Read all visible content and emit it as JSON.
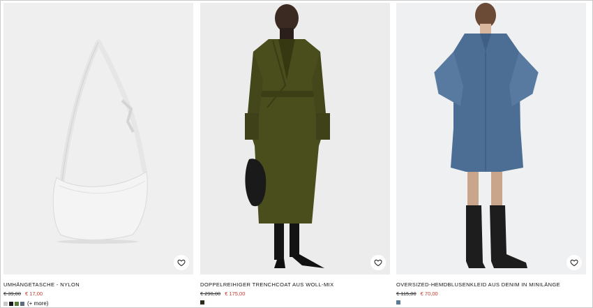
{
  "products": [
    {
      "name": "UMHÄNGETASCHE - NYLON",
      "old_price": "€ 39,00",
      "new_price": "€ 17,00",
      "swatches": [
        "#c8c8c8",
        "#1a1a1a",
        "#5a7a3a",
        "#5c6d80"
      ],
      "more_label": "(+ more)",
      "favorite_icon": "heart-icon",
      "image_bg": "#efefef"
    },
    {
      "name": "DOPPELREIHIGER TRENCHCOAT AUS WOLL-MIX",
      "old_price": "€ 290,00",
      "new_price": "€ 175,00",
      "swatches": [
        "#2e2a1a"
      ],
      "favorite_icon": "heart-icon",
      "image_bg": "#ececec"
    },
    {
      "name": "OVERSIZED-HEMDBLUSENKLEID AUS DENIM IN MINILÄNGE",
      "old_price": "€ 115,00",
      "new_price": "€ 70,00",
      "swatches": [
        "#5b7a94"
      ],
      "favorite_icon": "heart-icon",
      "image_bg": "#eef0f1"
    }
  ],
  "colors": {
    "sale_price": "#c0392b",
    "coat": "#4a4d1c",
    "denim": "#4d6e94",
    "bag": "#eeeeee"
  }
}
